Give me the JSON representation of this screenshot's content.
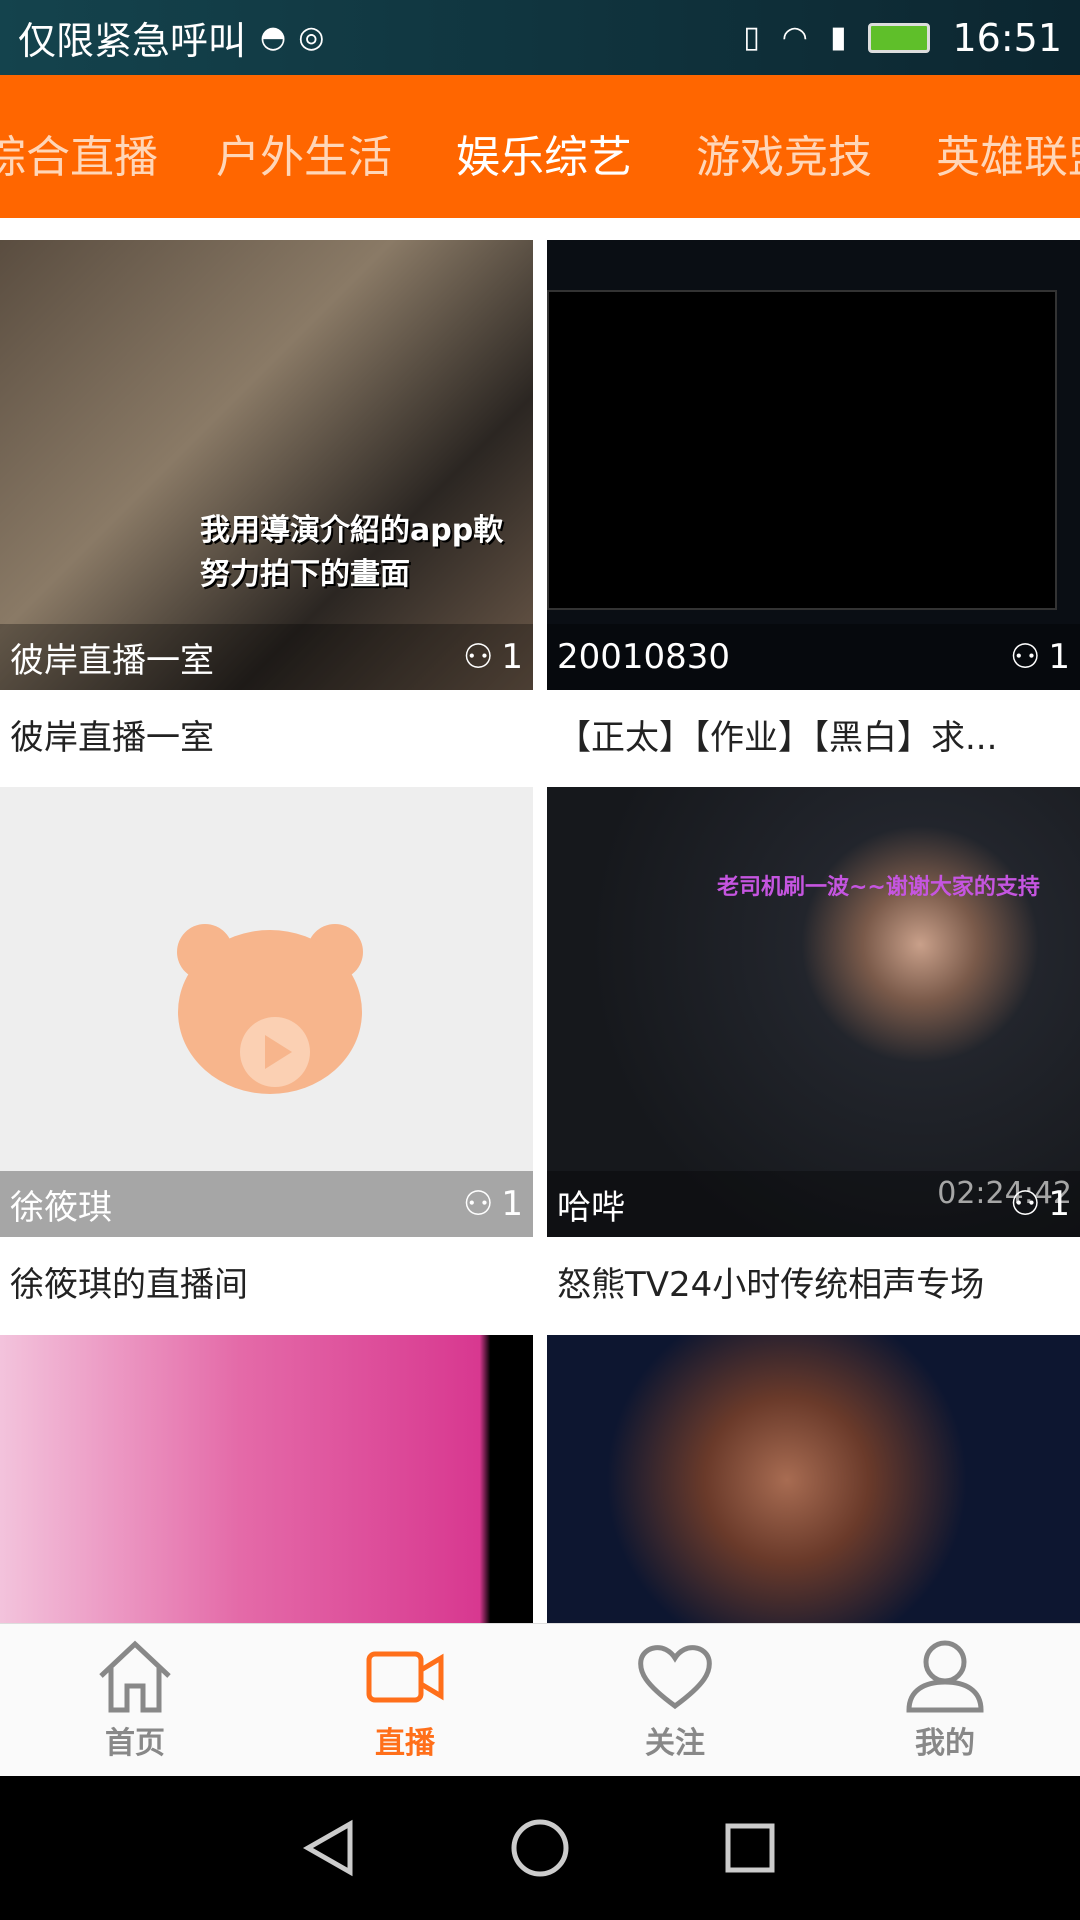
{
  "status_bar": {
    "carrier": "仅限紧急呼叫",
    "time": "16:51",
    "icons": [
      "android-icon",
      "sync-icon",
      "vibrate-icon",
      "wifi-icon",
      "sim-icon",
      "battery-charging-icon"
    ]
  },
  "tabs": [
    {
      "label": "综合直播"
    },
    {
      "label": "户外生活"
    },
    {
      "label": "娱乐综艺",
      "active": true
    },
    {
      "label": "游戏竞技"
    },
    {
      "label": "英雄联盟"
    }
  ],
  "accent": "#ff6600",
  "cards": [
    {
      "overlay_name": "彼岸直播一室",
      "viewers": "1",
      "title": "彼岸直播一室",
      "caption": "我用導演介紹的app軟 努力拍下的畫面"
    },
    {
      "overlay_name": "20010830",
      "viewers": "1",
      "title": "【正太】【作业】【黑白】求..."
    },
    {
      "overlay_name": "徐筱琪",
      "viewers": "1",
      "title": "徐筱琪的直播间",
      "placeholder": "bear-logo-icon"
    },
    {
      "overlay_name": "哈哔",
      "viewers": "1",
      "title": "怒熊TV24小时传统相声专场",
      "caption": "老司机刷一波~~谢谢大家的支持",
      "timestamp": "02:24:42"
    },
    {
      "overlay_name": "",
      "viewers": "",
      "title": ""
    },
    {
      "overlay_name": "",
      "viewers": "",
      "title": ""
    }
  ],
  "bottom_nav": [
    {
      "label": "首页",
      "icon": "home-icon"
    },
    {
      "label": "直播",
      "icon": "video-camera-icon",
      "active": true
    },
    {
      "label": "关注",
      "icon": "heart-icon"
    },
    {
      "label": "我的",
      "icon": "user-icon"
    }
  ]
}
